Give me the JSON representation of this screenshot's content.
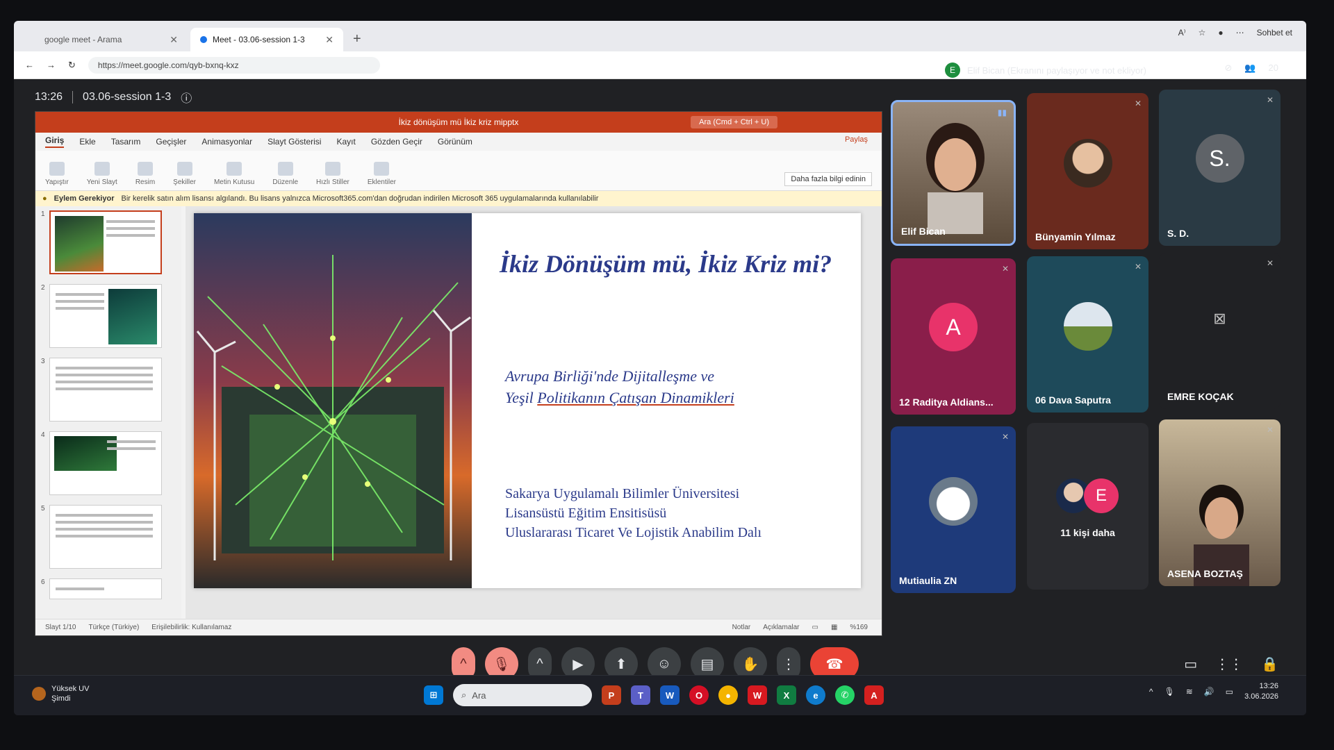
{
  "browser": {
    "tabs": [
      {
        "label": "google meet - Arama",
        "active": false
      },
      {
        "label": "Meet - 03.06-session 1-3",
        "active": true
      }
    ],
    "url": "https://meet.google.com/qyb-bxnq-kxz",
    "sohbet_label": "Sohbet et"
  },
  "meet": {
    "time": "13:26",
    "meeting_title": "03.06-session 1-3",
    "presenter_badge": "E",
    "presenting_text": "Elif Bican (Ekranını paylaşıyor ve not ekliyor)",
    "participant_count": "20"
  },
  "ppt": {
    "file_title": "İkiz dönüşüm mü İkiz kriz mipptx",
    "search_placeholder": "Ara (Cmd + Ctrl + U)",
    "share_label": "Paylaş",
    "menu": [
      "Giriş",
      "Ekle",
      "Tasarım",
      "Geçişler",
      "Animasyonlar",
      "Slayt Gösterisi",
      "Kayıt",
      "Gözden Geçir",
      "Görünüm"
    ],
    "ribbon": [
      "Yapıştır",
      "Yeni Slayt",
      "Resim",
      "Şekiller",
      "Metin Kutusu",
      "Düzenle",
      "Hızlı Stiller",
      "Eklentiler"
    ],
    "more_info": "Daha fazla bilgi edinin",
    "notice_title": "Eylem Gerekiyor",
    "notice_text": "Bir kerelik satın alım lisansı algılandı. Bu lisans yalnızca Microsoft365.com'dan doğrudan indirilen Microsoft 365 uygulamalarında kullanılabilir",
    "thumbs": [
      "1",
      "2",
      "3",
      "4",
      "5",
      "6"
    ],
    "slide": {
      "title": "İkiz Dönüşüm mü, İkiz Kriz mi?",
      "subtitle_line1": "Avrupa Birliği'nde Dijitalleşme ve",
      "subtitle_line2_a": "Yeşil ",
      "subtitle_line2_b": "Politikanın Çatışan Dinamikleri",
      "inst1": "Sakarya Uygulamalı Bilimler Üniversitesi",
      "inst2": "Lisansüstü Eğitim Ensitisüsü",
      "inst3": "Uluslararası Ticaret Ve Lojistik Anabilim Dalı"
    },
    "status": {
      "slide": "Slayt 1/10",
      "language": "Türkçe (Türkiye)",
      "accessibility": "Erişilebilirlik: Kullanılamaz",
      "notes": "Notlar",
      "comments": "Açıklamalar",
      "zoom": "%169"
    }
  },
  "participants": [
    {
      "name": "Elif Bican"
    },
    {
      "name": "Bünyamin Yılmaz"
    },
    {
      "name": "S. D.",
      "letter": "S."
    },
    {
      "name": "12 Raditya Aldians...",
      "letter": "A"
    },
    {
      "name": "06 Dava Saputra"
    },
    {
      "name": "EMRE KOÇAK"
    },
    {
      "name": "Mutiaulia ZN"
    },
    {
      "name": "11 kişi daha",
      "letter": "E"
    },
    {
      "name": "ASENA BOZTAŞ"
    }
  ],
  "taskbar": {
    "search_placeholder": "Ara",
    "time": "13:26",
    "date": "3.06.2026",
    "weather_title": "Yüksek UV",
    "weather_sub": "Şimdi"
  },
  "colors": {
    "meet_bg": "#202124",
    "ppt_accent": "#c43e1c",
    "end_call": "#ea4335",
    "slide_text": "#2b3a8a"
  }
}
